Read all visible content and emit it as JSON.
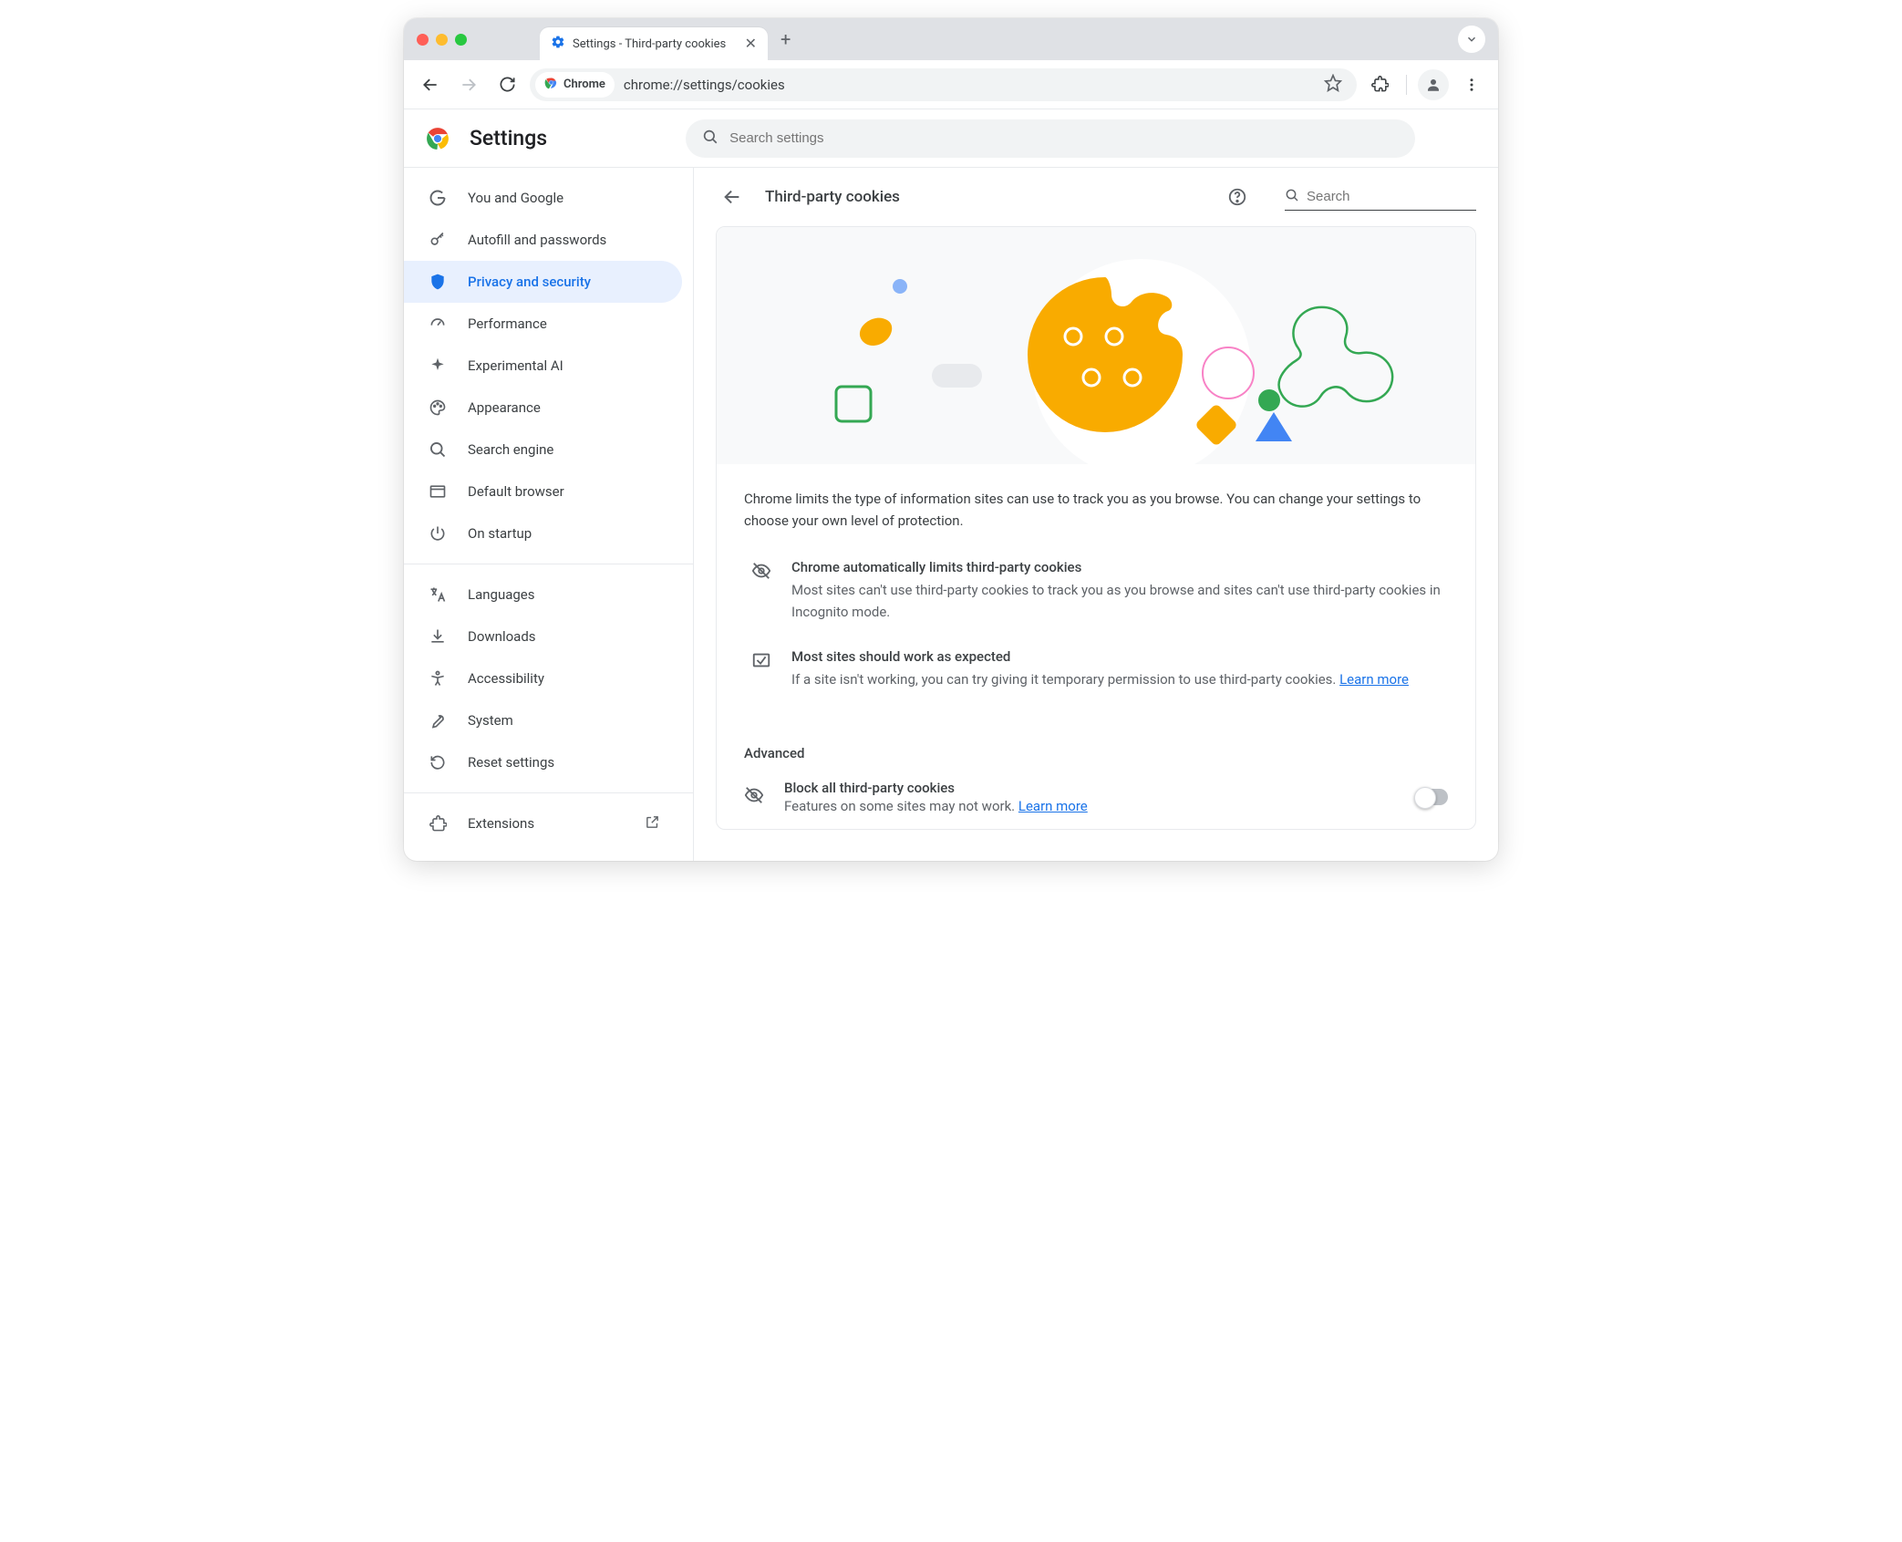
{
  "browser": {
    "tab_title": "Settings - Third-party cookies",
    "chip_label": "Chrome",
    "url": "chrome://settings/cookies"
  },
  "header": {
    "title": "Settings",
    "search_placeholder": "Search settings"
  },
  "sidebar": {
    "items": {
      "you": "You and Google",
      "autofill": "Autofill and passwords",
      "privacy": "Privacy and security",
      "performance": "Performance",
      "ai": "Experimental AI",
      "appearance": "Appearance",
      "search": "Search engine",
      "default": "Default browser",
      "startup": "On startup",
      "languages": "Languages",
      "downloads": "Downloads",
      "accessibility": "Accessibility",
      "system": "System",
      "reset": "Reset settings",
      "extensions": "Extensions"
    }
  },
  "page": {
    "title": "Third-party cookies",
    "search_placeholder": "Search",
    "description": "Chrome limits the type of information sites can use to track you as you browse. You can change your settings to choose your own level of protection.",
    "info1_title": "Chrome automatically limits third-party cookies",
    "info1_body": "Most sites can't use third-party cookies to track you as you browse and sites can't use third-party cookies in Incognito mode.",
    "info2_title": "Most sites should work as expected",
    "info2_body": "If a site isn't working, you can try giving it temporary permission to use third-party cookies. ",
    "learn_more": "Learn more",
    "advanced_label": "Advanced",
    "block_title": "Block all third-party cookies",
    "block_body": "Features on some sites may not work. "
  }
}
